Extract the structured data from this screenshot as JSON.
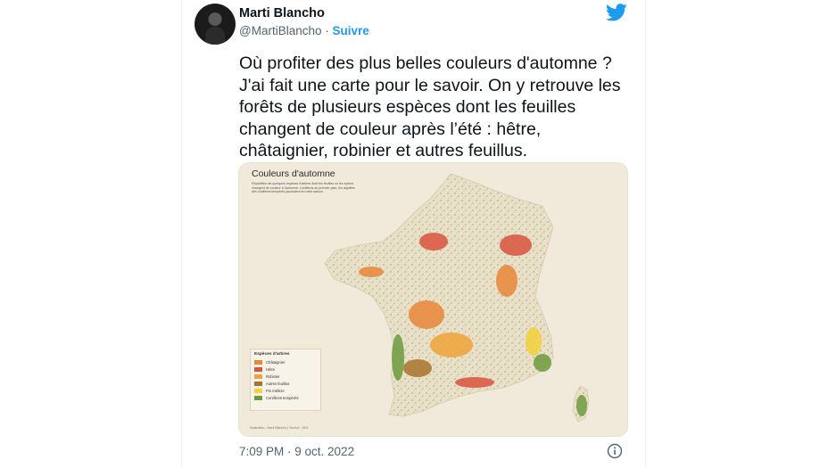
{
  "tweet": {
    "author": {
      "display_name": "Marti Blancho",
      "handle": "@MartiBlancho",
      "separator": "·",
      "follow_label": "Suivre"
    },
    "text": "Où profiter des plus belles couleurs d'automne ? J'ai fait une carte pour le savoir. On y retrouve les forêts de plusieurs espèces dont les feuilles changent de couleur après l’été : hêtre, châtaignier, robinier et autres feuillus.",
    "timestamp": "7:09 PM · 9 oct. 2022",
    "icons": [
      "twitter-bird-icon",
      "info-icon"
    ],
    "brand_color": "#1d9bf0"
  },
  "map": {
    "title": "Couleurs d'automne",
    "subtitle": "Répartition de quelques espèces d'arbres dont les feuilles ou les épines changent de couleur à l'automne. Conifères au premier plan, les aiguilles des conifères tempérés jaunissent en cette saison.",
    "legend": {
      "title": "Espèces d'arbres",
      "items": [
        {
          "label": "Châtaignier",
          "color": "#e8873a"
        },
        {
          "label": "Hêtre",
          "color": "#d9543f"
        },
        {
          "label": "Robinier",
          "color": "#f0a33a"
        },
        {
          "label": "Autres feuillus",
          "color": "#a8742c"
        },
        {
          "label": "Pin mélèze",
          "color": "#f2d13b"
        },
        {
          "label": "Conifères tempérés",
          "color": "#6d9a3e"
        }
      ]
    },
    "credit": "Illustration : Marti Blancho | Source : IGN"
  }
}
